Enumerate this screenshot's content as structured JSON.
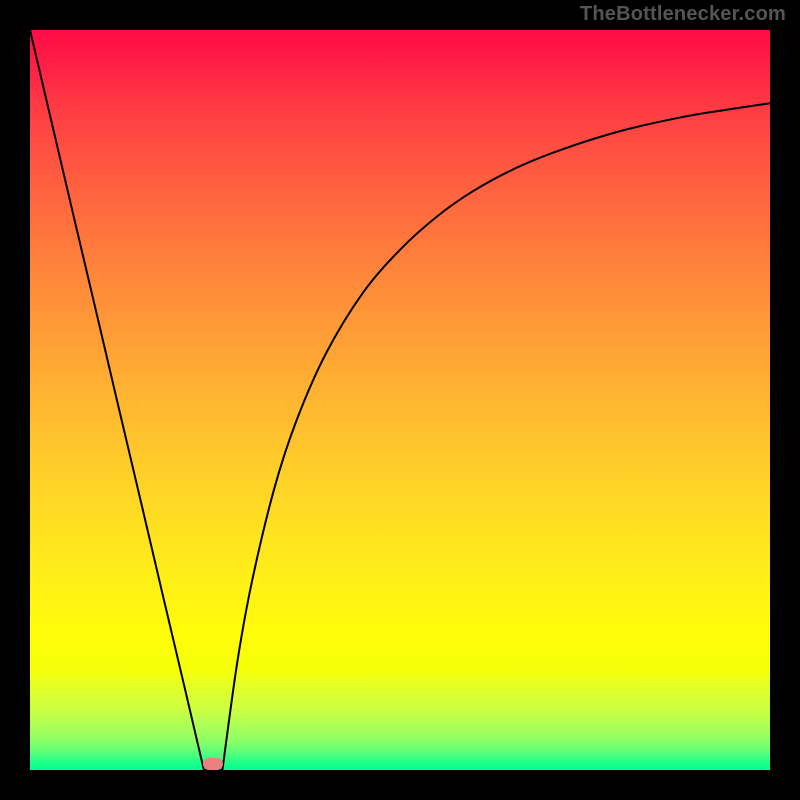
{
  "watermark": "TheBottlenecker.com",
  "marker": {
    "x_frac": 0.247,
    "y_frac": 0.992
  },
  "chart_data": {
    "type": "line",
    "title": "",
    "xlabel": "",
    "ylabel": "",
    "xlim": [
      0,
      1
    ],
    "ylim": [
      0,
      1
    ],
    "series": [
      {
        "name": "left-falling",
        "x": [
          0.0,
          0.03,
          0.06,
          0.09,
          0.12,
          0.15,
          0.18,
          0.21,
          0.235
        ],
        "y": [
          1.0,
          0.872,
          0.744,
          0.617,
          0.489,
          0.362,
          0.234,
          0.107,
          0.0
        ]
      },
      {
        "name": "right-rising",
        "x": [
          0.26,
          0.28,
          0.3,
          0.33,
          0.36,
          0.4,
          0.45,
          0.5,
          0.55,
          0.6,
          0.66,
          0.72,
          0.8,
          0.88,
          0.94,
          1.0
        ],
        "y": [
          0.0,
          0.145,
          0.255,
          0.38,
          0.472,
          0.563,
          0.645,
          0.703,
          0.748,
          0.783,
          0.815,
          0.839,
          0.864,
          0.882,
          0.892,
          0.901
        ]
      }
    ],
    "background_gradient_stops": [
      {
        "t": 0.0,
        "color": "#ff0b47"
      },
      {
        "t": 0.054,
        "color": "#ff2346"
      },
      {
        "t": 0.108,
        "color": "#ff3c44"
      },
      {
        "t": 0.162,
        "color": "#ff5042"
      },
      {
        "t": 0.216,
        "color": "#ff6240"
      },
      {
        "t": 0.27,
        "color": "#ff733d"
      },
      {
        "t": 0.324,
        "color": "#ff843b"
      },
      {
        "t": 0.378,
        "color": "#ff9438"
      },
      {
        "t": 0.432,
        "color": "#ffa335"
      },
      {
        "t": 0.486,
        "color": "#ffb232"
      },
      {
        "t": 0.541,
        "color": "#ffc02e"
      },
      {
        "t": 0.595,
        "color": "#ffce29"
      },
      {
        "t": 0.649,
        "color": "#ffdb24"
      },
      {
        "t": 0.703,
        "color": "#ffe71d"
      },
      {
        "t": 0.757,
        "color": "#fff215"
      },
      {
        "t": 0.811,
        "color": "#fffc09"
      },
      {
        "t": 0.865,
        "color": "#f6ff09"
      },
      {
        "t": 0.892,
        "color": "#e0ff2d"
      },
      {
        "t": 0.919,
        "color": "#cbff40"
      },
      {
        "t": 0.932,
        "color": "#b7ff4e"
      },
      {
        "t": 0.946,
        "color": "#a3ff5a"
      },
      {
        "t": 0.959,
        "color": "#8fff64"
      },
      {
        "t": 0.966,
        "color": "#7aff6d"
      },
      {
        "t": 0.973,
        "color": "#64ff76"
      },
      {
        "t": 0.98,
        "color": "#4bff7e"
      },
      {
        "t": 0.986,
        "color": "#2dff87"
      },
      {
        "t": 1.0,
        "color": "#00ff91"
      }
    ]
  }
}
